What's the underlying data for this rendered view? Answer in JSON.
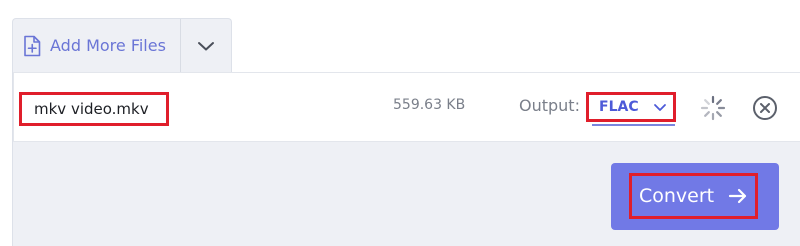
{
  "toolbar": {
    "add_files_label": "Add More Files",
    "icons": {
      "add_file": "file-plus-icon",
      "dropdown": "chevron-down-icon"
    }
  },
  "file": {
    "name": "mkv video.mkv",
    "size": "559.63 KB",
    "output_label": "Output:",
    "output_format": "FLAC",
    "icons": {
      "format_dropdown": "chevron-down-icon",
      "status": "loading-spinner-icon",
      "remove": "close-circle-icon"
    }
  },
  "convert": {
    "label": "Convert",
    "icon": "arrow-right-icon"
  },
  "colors": {
    "accent": "#7179e6",
    "link": "#4d5ad8",
    "highlight": "#e01e2b",
    "panel_bg": "#eef0f5"
  }
}
